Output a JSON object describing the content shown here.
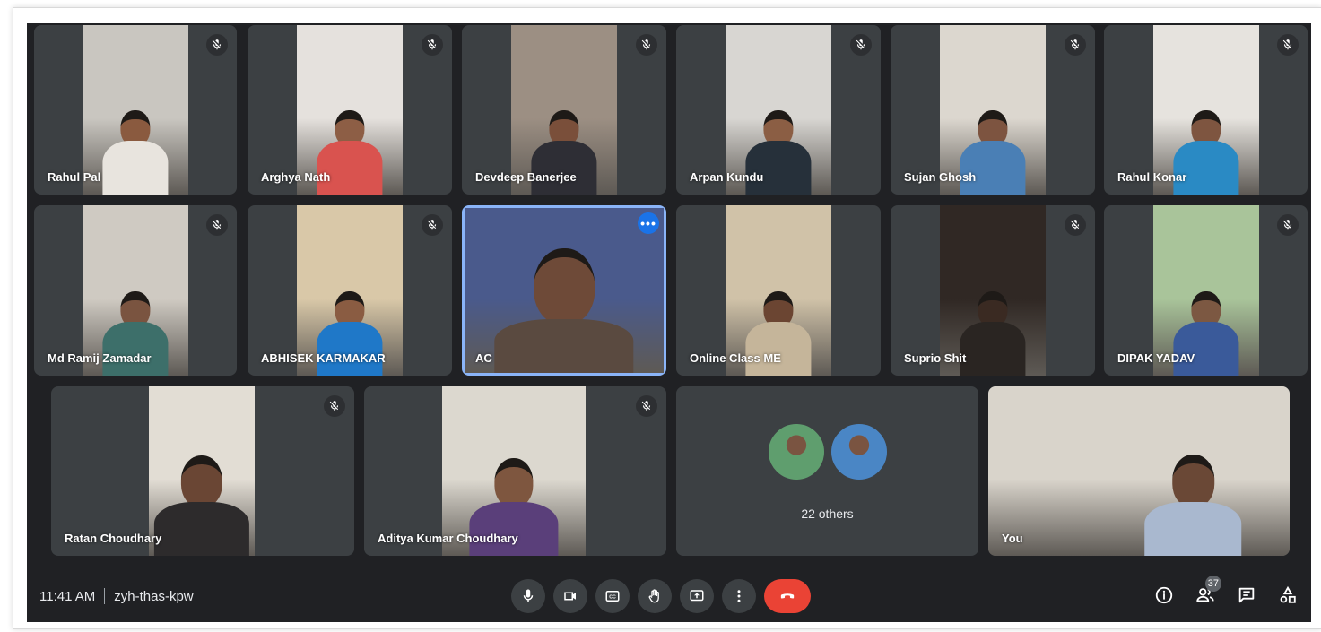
{
  "meeting": {
    "time": "11:41 AM",
    "code": "zyh-thas-kpw",
    "participant_count": "37"
  },
  "tiles": [
    {
      "name": "Rahul Pal",
      "muted": true,
      "skin": "#8a5a3f",
      "shirt": "#e8e4de",
      "bg": "#c9c6c0"
    },
    {
      "name": "Arghya Nath",
      "muted": true,
      "skin": "#8d5e45",
      "shirt": "#d9534f",
      "bg": "#e5e1dd"
    },
    {
      "name": "Devdeep Banerjee",
      "muted": true,
      "skin": "#7a4f3a",
      "shirt": "#2e2e35",
      "bg": "#9c8f83"
    },
    {
      "name": "Arpan Kundu",
      "muted": true,
      "skin": "#8b5e44",
      "shirt": "#26303a",
      "bg": "#d8d6d2"
    },
    {
      "name": "Sujan Ghosh",
      "muted": true,
      "skin": "#7d5440",
      "shirt": "#4a7fb5",
      "bg": "#dcd7cf"
    },
    {
      "name": "Rahul Konar",
      "muted": true,
      "skin": "#7e5540",
      "shirt": "#2a8ac4",
      "bg": "#e6e3de"
    },
    {
      "name": "Md Ramij Zamadar",
      "muted": true,
      "skin": "#7a5440",
      "shirt": "#3d6f6a",
      "bg": "#cfcac2"
    },
    {
      "name": "ABHISEK KARMAKAR",
      "muted": true,
      "skin": "#8a5c42",
      "shirt": "#1f78c8",
      "bg": "#d9c8a8"
    },
    {
      "name": "AC",
      "muted": false,
      "active": true,
      "skin": "#6e4a38",
      "shirt": "#5a4a40",
      "bg": "#4a5a8c"
    },
    {
      "name": "Online Class ME",
      "muted": false,
      "skin": "#6b4532",
      "shirt": "#c5b59a",
      "bg": "#d0c2a8"
    },
    {
      "name": "Suprio Shit",
      "muted": true,
      "skin": "#3a2a22",
      "shirt": "#2a2522",
      "bg": "#302824"
    },
    {
      "name": "DIPAK YADAV",
      "muted": true,
      "skin": "#7c5842",
      "shirt": "#3a5a9a",
      "bg": "#a9c49a"
    },
    {
      "name": "Ratan Choudhary",
      "muted": true,
      "skin": "#6a4634",
      "shirt": "#2d2b2c",
      "bg": "#e2ddd4"
    },
    {
      "name": "Aditya Kumar Choudhary",
      "muted": true,
      "skin": "#7e563f",
      "shirt": "#5a3f7a",
      "bg": "#dcd8cf"
    },
    {
      "name": "You",
      "muted": false,
      "skin": "#6a4836",
      "shirt": "#a9b8cf",
      "bg": "#d9d4cb"
    }
  ],
  "others": {
    "label": "22 others",
    "avatar_colors": [
      "#5f9e6e",
      "#4a86c5"
    ]
  },
  "controls": [
    "mic-button",
    "camera-button",
    "captions-button",
    "raise-hand-button",
    "present-button",
    "more-options-button",
    "leave-call-button"
  ],
  "colors": {
    "background": "#202124",
    "tile": "#3c4043",
    "active_outline": "#8ab4f8",
    "end_call": "#ea4335"
  }
}
